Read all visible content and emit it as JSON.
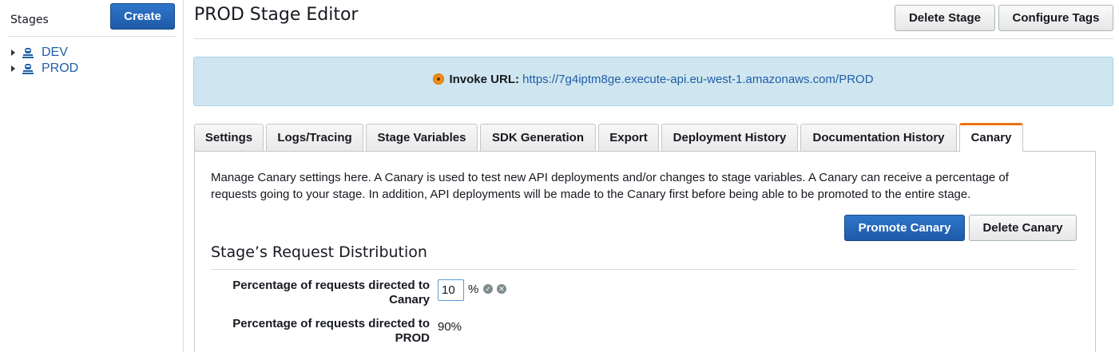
{
  "sidebar": {
    "title": "Stages",
    "create_label": "Create",
    "items": [
      {
        "label": "DEV",
        "icon": "stage-icon"
      },
      {
        "label": "PROD",
        "icon": "stage-icon"
      }
    ]
  },
  "header": {
    "title": "PROD Stage Editor",
    "delete_stage_label": "Delete Stage",
    "configure_tags_label": "Configure Tags"
  },
  "invoke": {
    "label": "Invoke URL:",
    "url": "https://7g4iptm8ge.execute-api.eu-west-1.amazonaws.com/PROD"
  },
  "tabs": [
    {
      "label": "Settings"
    },
    {
      "label": "Logs/Tracing"
    },
    {
      "label": "Stage Variables"
    },
    {
      "label": "SDK Generation"
    },
    {
      "label": "Export"
    },
    {
      "label": "Deployment History"
    },
    {
      "label": "Documentation History"
    },
    {
      "label": "Canary",
      "active": true
    }
  ],
  "canary": {
    "description": "Manage Canary settings here. A Canary is used to test new API deployments and/or changes to stage variables. A Canary can receive a percentage of requests going to your stage. In addition, API deployments will be made to the Canary first before being able to be promoted to the entire stage.",
    "promote_label": "Promote Canary",
    "delete_label": "Delete Canary",
    "section_title": "Stage’s Request Distribution",
    "canary_pct_label": "Percentage of requests directed to Canary",
    "canary_pct_value": "10",
    "pct_symbol": "%",
    "prod_pct_label": "Percentage of requests directed to PROD",
    "prod_pct_value": "90%"
  },
  "colors": {
    "primary_button": "#1e5aa8",
    "active_tab_accent": "#ec7211",
    "invoke_background": "#cfe6f0",
    "link": "#1f5ea8"
  }
}
